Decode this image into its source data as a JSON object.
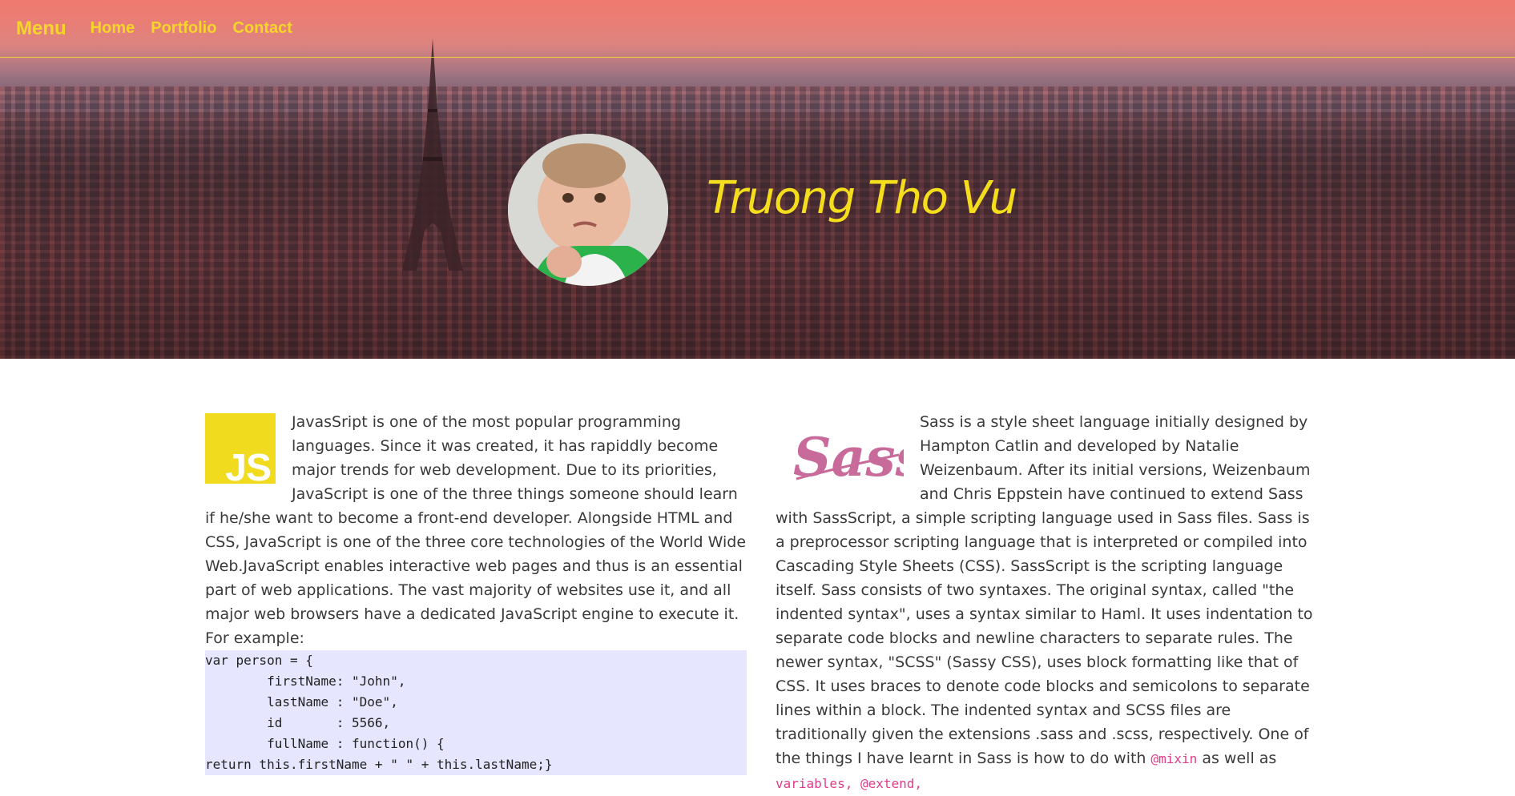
{
  "nav": {
    "brand": "Menu",
    "links": [
      "Home",
      "Portfolio",
      "Contact"
    ]
  },
  "hero": {
    "name": "Truong Tho Vu",
    "avatar_icon": "profile-photo"
  },
  "colors": {
    "accent_yellow": "#f6d52b",
    "code_bg": "#e6e6fe",
    "inline_code": "#e03c8a",
    "js_yellow": "#f0db1e",
    "sass_pink": "#c86b9a"
  },
  "left_article": {
    "logo_text": "JS",
    "text": "JavasSript is one of the most popular programming languages. Since it was created, it has rapiddly become major trends for web development. Due to its priorities, JavaScript is one of the three things someone should learn if he/she want to become a front-end developer. Alongside HTML and CSS, JavaScript is one of the three core technologies of the World Wide Web.JavaScript enables interactive web pages and thus is an essential part of web applications. The vast majority of websites use it, and all major web browsers have a dedicated JavaScript engine to execute it. For example:",
    "code": "var person = {\n\tfirstName: \"John\",\n\tlastName : \"Doe\",\n\tid       : 5566,\n\tfullName : function() {\nreturn this.firstName + \" \" + this.lastName;}"
  },
  "right_article": {
    "logo_text": "Sass",
    "text_before": "Sass is a style sheet language initially designed by Hampton Catlin and developed by Natalie Weizenbaum. After its initial versions, Weizenbaum and Chris Eppstein have continued to extend Sass with SassScript, a simple scripting language used in Sass files. Sass is a preprocessor scripting language that is interpreted or compiled into Cascading Style Sheets (CSS). SassScript is the scripting language itself. Sass consists of two syntaxes. The original syntax, called \"the indented syntax\", uses a syntax similar to Haml. It uses indentation to separate code blocks and newline characters to separate rules. The newer syntax, \"SCSS\" (Sassy CSS), uses block formatting like that of CSS. It uses braces to denote code blocks and semicolons to separate lines within a block. The indented syntax and SCSS files are traditionally given the extensions .sass and .scss, respectively. One of the things I have learnt in Sass is how to do with ",
    "code_mixin": "@mixin",
    "text_middle": " as well as ",
    "code_more": "variables, @extend,"
  }
}
